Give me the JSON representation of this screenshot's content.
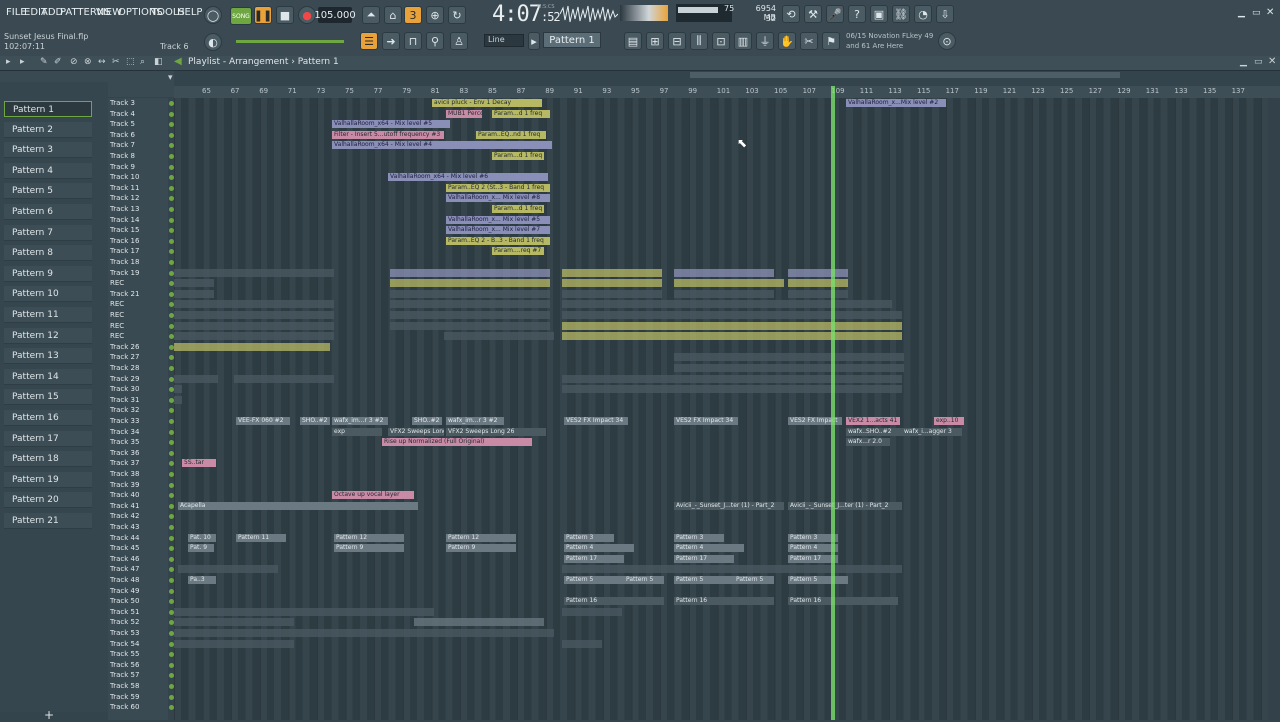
{
  "menu": [
    "FILE",
    "EDIT",
    "ADD",
    "PATTERNS",
    "VIEW",
    "OPTIONS",
    "TOOLS",
    "HELP"
  ],
  "transport": {
    "mode_label": "SONG",
    "tempo": "105.000",
    "clock": "4:07",
    "clock_ms": ":52",
    "clock_tag": "M:S:CS"
  },
  "meters": {
    "memory": "6954 MB",
    "voices": "32",
    "cpu": "75"
  },
  "project": {
    "name": "Sunset Jesus Final.flp",
    "position": "102:07:11",
    "current_track": "Track 6"
  },
  "snap": {
    "value": "Line"
  },
  "pattern_selector": {
    "value": "Pattern 1"
  },
  "hint": {
    "line1": "06/15  Novation FLkey 49",
    "line2": "and 61 Are Here"
  },
  "playlist": {
    "title": "Playlist - Arrangement",
    "breadcrumb": "Pattern 1"
  },
  "patterns": [
    "Pattern 1",
    "Pattern 2",
    "Pattern 3",
    "Pattern 4",
    "Pattern 5",
    "Pattern 6",
    "Pattern 7",
    "Pattern 8",
    "Pattern 9",
    "Pattern 10",
    "Pattern 11",
    "Pattern 12",
    "Pattern 13",
    "Pattern 14",
    "Pattern 15",
    "Pattern 16",
    "Pattern 17",
    "Pattern 18",
    "Pattern 19",
    "Pattern 20",
    "Pattern 21"
  ],
  "tracks": [
    "Track 3",
    "Track 4",
    "Track 5",
    "Track 6",
    "Track 7",
    "Track 8",
    "Track 9",
    "Track 10",
    "Track 11",
    "Track 12",
    "Track 13",
    "Track 14",
    "Track 15",
    "Track 16",
    "Track 17",
    "Track 18",
    "Track 19",
    "REC",
    "Track 21",
    "REC",
    "REC",
    "REC",
    "REC",
    "Track 26",
    "Track 27",
    "Track 28",
    "Track 29",
    "Track 30",
    "Track 31",
    "Track 32",
    "Track 33",
    "Track 34",
    "Track 35",
    "Track 36",
    "Track 37",
    "Track 38",
    "Track 39",
    "Track 40",
    "Track 41",
    "Track 42",
    "Track 43",
    "Track 44",
    "Track 45",
    "Track 46",
    "Track 47",
    "Track 48",
    "Track 49",
    "Track 50",
    "Track 51",
    "Track 52",
    "Track 53",
    "Track 54",
    "Track 55",
    "Track 56",
    "Track 57",
    "Track 58",
    "Track 59",
    "Track 60"
  ],
  "ruler": [
    "65",
    "67",
    "69",
    "71",
    "73",
    "75",
    "77",
    "79",
    "81",
    "83",
    "85",
    "87",
    "89",
    "91",
    "93",
    "95",
    "97",
    "99",
    "101",
    "103",
    "105",
    "107",
    "109",
    "111",
    "113",
    "115",
    "117",
    "119",
    "121",
    "123",
    "125",
    "127",
    "129",
    "131",
    "133",
    "135",
    "137"
  ],
  "clips": [
    {
      "label": "avicii pluck - Env 1 Decay"
    },
    {
      "label": "MUB1 Perco"
    },
    {
      "label": "Param...d 1 freq"
    },
    {
      "label": "ValhallaRoom_x64 - Mix level #5"
    },
    {
      "label": "Filter - Insert 5...utoff frequency #3"
    },
    {
      "label": "Param..EQ..nd 1 freq"
    },
    {
      "label": "ValhallaRoom_x64 - Mix level #4"
    },
    {
      "label": "Param...d 1 freq"
    },
    {
      "label": "ValhallaRoom_x64 - Mix level #6"
    },
    {
      "label": "Param..EQ 2 (St..3 - Band 1 freq"
    },
    {
      "label": "ValhallaRoom_x... Mix level #8"
    },
    {
      "label": "Param...d 1 freq"
    },
    {
      "label": "ValhallaRoom_x... Mix level #5"
    },
    {
      "label": "ValhallaRoom_x... Mix level #7"
    },
    {
      "label": "Param..EQ 2 - B..3 - Band 1 freq"
    },
    {
      "label": "Param....req #7"
    },
    {
      "label": "ValhallaRoom_x...Mix level #2"
    },
    {
      "label": "VEE-FX 060 #2"
    },
    {
      "label": "SHO..#2"
    },
    {
      "label": "wafx_im...r 3 #2"
    },
    {
      "label": "SHO..#2"
    },
    {
      "label": "wafx_im...r 3 #2"
    },
    {
      "label": "VES2 FX Impact 34"
    },
    {
      "label": "VES2 FX Impact 34"
    },
    {
      "label": "VES2 FX Impact"
    },
    {
      "label": "VEX2 1...acts 41"
    },
    {
      "label": "exp..10"
    },
    {
      "label": "exp"
    },
    {
      "label": "VFX2 Sweeps Long 26"
    },
    {
      "label": "VFX2 Sweeps Long 26"
    },
    {
      "label": "wafx..SHO..#2"
    },
    {
      "label": "wafx_i...agger 3"
    },
    {
      "label": "Rise up Normalized (Full Original)"
    },
    {
      "label": "wafx...r 2.0"
    },
    {
      "label": "5S..tar"
    },
    {
      "label": "Octave up vocal layer"
    },
    {
      "label": "Acapella"
    },
    {
      "label": "Avicii_-_Sunset_J...ter (1) - Part_2"
    },
    {
      "label": "Avicii_-_Sunset_J...ter (1) - Part_2"
    },
    {
      "label": "Pat. 10"
    },
    {
      "label": "Pattern 11"
    },
    {
      "label": "Pattern 12"
    },
    {
      "label": "Pattern 12"
    },
    {
      "label": "Pattern 3"
    },
    {
      "label": "Pattern 3"
    },
    {
      "label": "Pattern 3"
    },
    {
      "label": "Pat. 9"
    },
    {
      "label": "Pattern 9"
    },
    {
      "label": "Pattern 9"
    },
    {
      "label": "Pattern 4"
    },
    {
      "label": "Pattern 4"
    },
    {
      "label": "Pattern 4"
    },
    {
      "label": "Pattern 17"
    },
    {
      "label": "Pattern 17"
    },
    {
      "label": "Pattern 17"
    },
    {
      "label": "Pa..3"
    },
    {
      "label": "Pattern 5"
    },
    {
      "label": "Pattern 5"
    },
    {
      "label": "Pattern 5"
    },
    {
      "label": "Pattern 5"
    },
    {
      "label": "Pattern 5"
    },
    {
      "label": "Pattern 16"
    },
    {
      "label": "Pattern 16"
    },
    {
      "label": "Pattern 16"
    }
  ]
}
